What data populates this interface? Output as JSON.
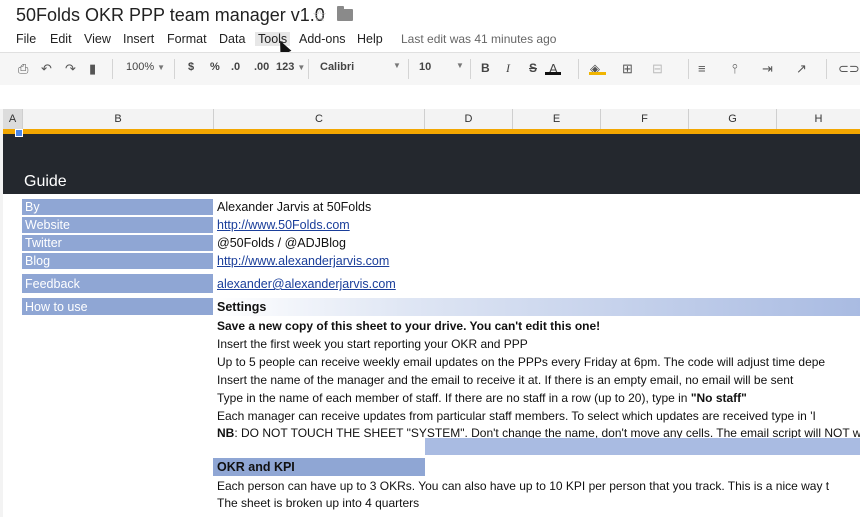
{
  "title_bar": {
    "title": "50Folds OKR PPP team manager v1.0",
    "star_icon": "☆",
    "folder_icon": "folder-icon"
  },
  "menu": {
    "items": [
      "File",
      "Edit",
      "View",
      "Insert",
      "Format",
      "Data",
      "Tools",
      "Add-ons",
      "Help"
    ],
    "last_edit": "Last edit was 41 minutes ago"
  },
  "toolbar": {
    "zoom": "100%",
    "currency": "$",
    "percent": "%",
    "dec_decrease": ".0",
    "dec_increase": ".00",
    "more_formats": "123",
    "font": "Calibri",
    "font_size": "10",
    "bold": "B",
    "italic": "I",
    "strike": "S",
    "text_color": "A",
    "colors": {
      "fill": "#f0b400",
      "text": "#111111"
    }
  },
  "columns": [
    "A",
    "B",
    "C",
    "D",
    "E",
    "F",
    "G",
    "H"
  ],
  "sheet": {
    "guide_title": "Guide",
    "info_rows": [
      {
        "label": "By",
        "value": "Alexander Jarvis at 50Folds",
        "link": false
      },
      {
        "label": "Website",
        "value": "http://www.50Folds.com",
        "link": true
      },
      {
        "label": "Twitter",
        "value": "@50Folds / @ADJBlog",
        "link": false
      },
      {
        "label": "Blog",
        "value": "http://www.alexanderjarvis.com",
        "link": true
      },
      {
        "label": "Feedback",
        "value": "alexander@alexanderjarvis.com",
        "link": true
      },
      {
        "label": "How to use",
        "value": "",
        "link": false
      }
    ],
    "settings_label": "Settings",
    "settings_lines": [
      {
        "text": "Save a new copy of this sheet to your drive. You can't edit this one!",
        "bold": true
      },
      {
        "text": "Insert the first week you start reporting your OKR and PPP"
      },
      {
        "text": "Up to 5 people can receive weekly email updates on the PPPs every Friday at 6pm. The code will adjust time depe"
      },
      {
        "text": "Insert the name of the manager and the email to receive it at. If there is an empty email, no email will be sent"
      },
      {
        "pre": "Type in the name of each member of staff. If there are no staff in a row (up to 20), type in ",
        "strong": "\"No staff\"",
        "post": ""
      },
      {
        "text": "Each manager can receive updates from particular staff members. To select which updates are received type in 'I"
      },
      {
        "pre": "",
        "strong": "NB",
        "post": ": DO NOT TOUCH THE SHEET \"SYSTEM\". Don't change the name, don't move any cells. The email script will NOT wo"
      }
    ],
    "okr_label": "OKR and KPI",
    "okr_lines": [
      "Each person can have up to 3 OKRs. You can also have up to 10 KPI per person that you track. This is a nice way t",
      "The sheet is broken up into 4 quarters"
    ]
  }
}
